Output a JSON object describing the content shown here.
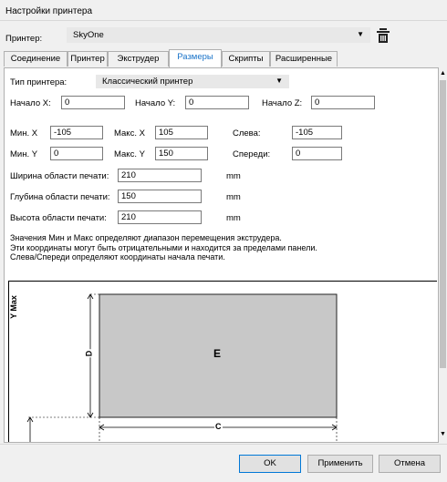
{
  "window": {
    "title": "Настройки принтера"
  },
  "printer": {
    "label": "Принтер:",
    "value": "SkyOne"
  },
  "tabs": [
    "Соединение",
    "Принтер",
    "Экструдер",
    "Размеры",
    "Скрипты",
    "Расширенные"
  ],
  "dimensions": {
    "printer_type_label": "Тип принтера:",
    "printer_type_value": "Классический принтер",
    "start_x_label": "Начало X:",
    "start_x": "0",
    "start_y_label": "Начало Y:",
    "start_y": "0",
    "start_z_label": "Начало Z:",
    "start_z": "0",
    "min_x_label": "Мин. X",
    "min_x": "-105",
    "max_x_label": "Макс. X",
    "max_x": "105",
    "left_label": "Слева:",
    "left": "-105",
    "min_y_label": "Мин. Y",
    "min_y": "0",
    "max_y_label": "Макс. Y",
    "max_y": "150",
    "front_label": "Спереди:",
    "front": "0",
    "width_label": "Ширина области печати:",
    "width": "210",
    "width_unit": "mm",
    "depth_label": "Глубина области печати:",
    "depth": "150",
    "depth_unit": "mm",
    "height_label": "Высота области печати:",
    "height": "210",
    "height_unit": "mm",
    "desc_1": "Значения Мин и Макс определяют диапазон перемещения экструдера.",
    "desc_2": "Эти координаты могут быть отрицательными и находится за пределами панели.",
    "desc_3": "Слева/Спереди определяют координаты начала печати."
  },
  "diagram": {
    "y_axis_label": "Y Max",
    "label_d": "D",
    "label_e": "E",
    "label_c": "C"
  },
  "buttons": {
    "ok": "OK",
    "apply": "Применить",
    "cancel": "Отмена"
  },
  "colors": {
    "active_tab": "#1a73c8",
    "bed_fill": "#c8c8c8",
    "combo_bg": "#e8e8e8"
  },
  "icons": {
    "delete": "trash-icon"
  }
}
